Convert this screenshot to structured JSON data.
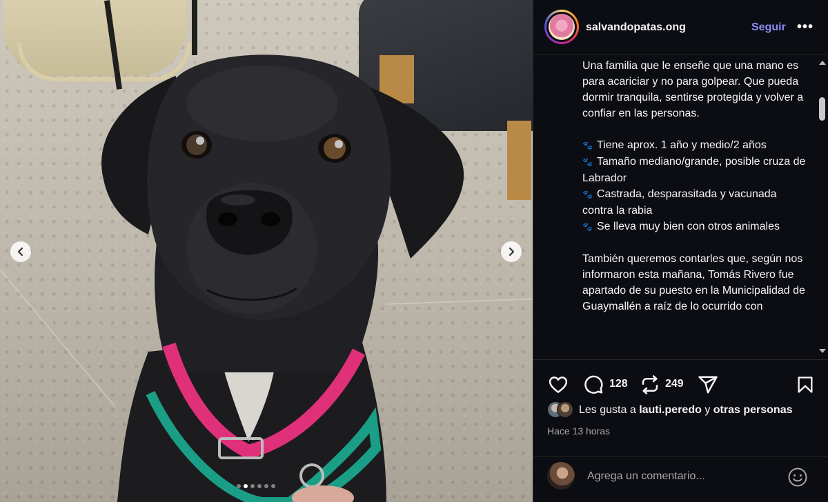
{
  "post": {
    "username": "salvandopatas.ong",
    "follow_label": "Seguir",
    "more_label": "•••",
    "caption": {
      "paragraph1": "Una familia que le enseñe que una mano es para acariciar y no para golpear. Que pueda dormir tranquila, sentirse protegida y volver a confiar en las personas.",
      "bullets": [
        "Tiene aprox. 1 año y medio/2 años",
        "Tamaño mediano/grande, posible cruza de Labrador",
        "Castrada, desparasitada y vacunada contra la rabia",
        "Se lleva muy bien con otros animales"
      ],
      "bullet_icon": "🐾",
      "paragraph2": "También queremos contarles que, según nos informaron esta mañana, Tomás Rivero fue apartado de su puesto en la Municipalidad de Guaymallén a raíz de lo ocurrido con"
    },
    "actions": {
      "comments_count": "128",
      "reposts_count": "249"
    },
    "likes": {
      "prefix": "Les gusta a",
      "user": "lauti.peredo",
      "conjunction": "y",
      "others": "otras personas"
    },
    "time": "Hace 13 horas",
    "comment_placeholder": "Agrega un comentario..."
  },
  "carousel": {
    "total_slides": 6,
    "active_slide": 2
  },
  "colors": {
    "follow": "#8a8cf5",
    "panel_bg": "#0c0d12",
    "text": "#f5f5f5",
    "muted": "#a8a8a8"
  }
}
